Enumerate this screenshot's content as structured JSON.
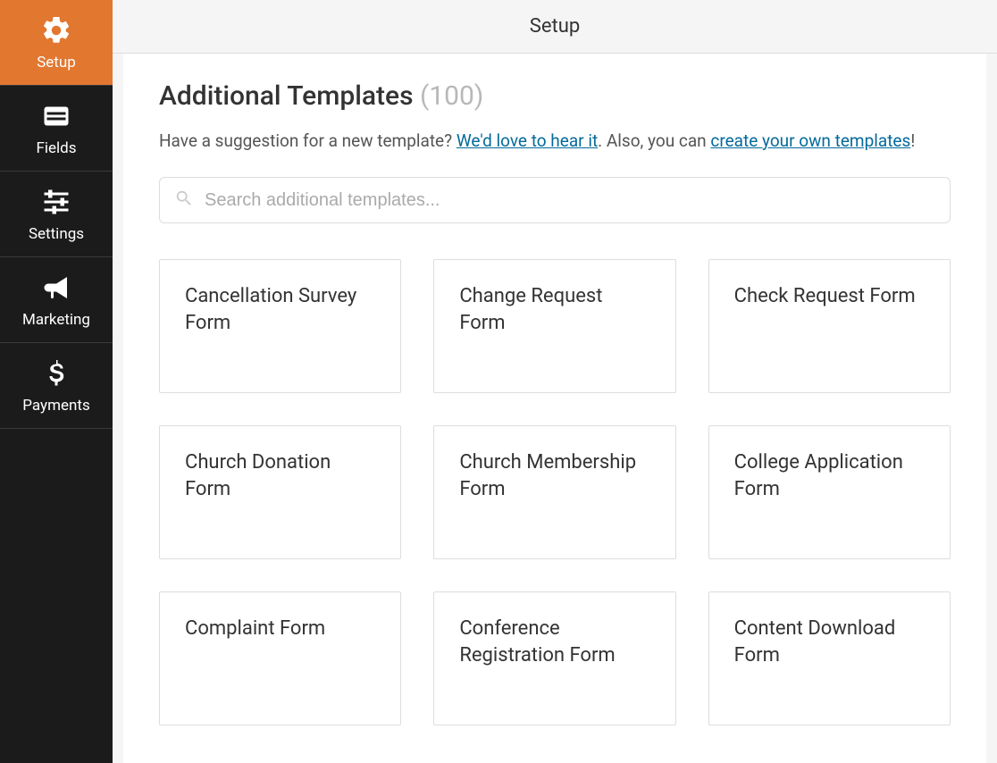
{
  "sidebar": {
    "items": [
      {
        "label": "Setup",
        "icon": "gear",
        "active": true
      },
      {
        "label": "Fields",
        "icon": "fields",
        "active": false
      },
      {
        "label": "Settings",
        "icon": "sliders",
        "active": false
      },
      {
        "label": "Marketing",
        "icon": "bullhorn",
        "active": false
      },
      {
        "label": "Payments",
        "icon": "dollar",
        "active": false
      }
    ]
  },
  "header": {
    "title": "Setup"
  },
  "section": {
    "title": "Additional Templates",
    "count_label": "(100)"
  },
  "intro": {
    "prefix": "Have a suggestion for a new template? ",
    "link1": "We'd love to hear it",
    "middle": ". Also, you can ",
    "link2": "create your own templates",
    "suffix": "!"
  },
  "search": {
    "placeholder": "Search additional templates..."
  },
  "templates": [
    {
      "title": "Cancellation Survey Form"
    },
    {
      "title": "Change Request Form"
    },
    {
      "title": "Check Request Form"
    },
    {
      "title": "Church Donation Form"
    },
    {
      "title": "Church Membership Form"
    },
    {
      "title": "College Application Form"
    },
    {
      "title": "Complaint Form"
    },
    {
      "title": "Conference Registration Form"
    },
    {
      "title": "Content Download Form"
    }
  ]
}
